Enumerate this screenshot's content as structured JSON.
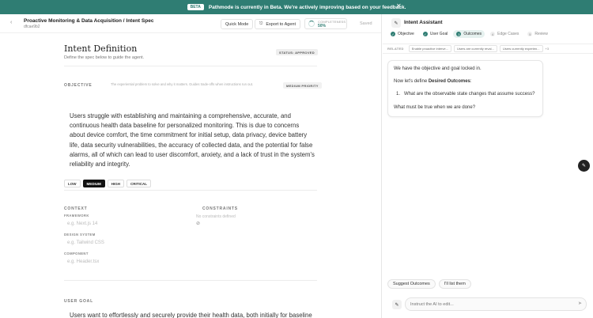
{
  "beta": {
    "badge": "BETA",
    "message": "Pathmode is currently in Beta. We're actively improving based on your feedback.",
    "close": "✕"
  },
  "topbar": {
    "title": "Proactive Monitoring & Data Acquisition / Intent Spec",
    "id": "dfcae9b2",
    "quick_mode": "Quick Mode",
    "export_label": "Export to Agent",
    "completeness_label": "COMPLETENESS",
    "completeness_value": "50%",
    "saved": "Saved"
  },
  "intent": {
    "title": "Intent Definition",
    "subtitle": "Define the spec below to guide the agent.",
    "status": "STATUS: APPROVED"
  },
  "objective": {
    "label": "OBJECTIVE",
    "description": "The experiential problem to solve and why it matters. Guides trade-offs when instructions run out.",
    "priority_badge": "MEDIUM PRIORITY",
    "text": "Users struggle with establishing and maintaining a comprehensive, accurate, and continuous health data baseline for personalized monitoring. This is due to concerns about device comfort, the time commitment for initial setup, data privacy, device battery life, data security vulnerabilities, the accuracy of collected data, and the potential for false alarms, all of which can lead to user discomfort, anxiety, and a lack of trust in the system's reliability and integrity.",
    "priorities": [
      "LOW",
      "MEDIUM",
      "HIGH",
      "CRITICAL"
    ],
    "selected_priority": "MEDIUM"
  },
  "context": {
    "label": "CONTEXT",
    "framework_label": "FRAMEWORK",
    "framework_ph": "e.g. Next.js 14",
    "design_label": "DESIGN SYSTEM",
    "design_ph": "e.g. Tailwind CSS",
    "component_label": "COMPONENT",
    "component_ph": "e.g. Header.tsx"
  },
  "constraints": {
    "label": "CONSTRAINTS",
    "empty": "No constraints defined"
  },
  "user_goal": {
    "label": "USER GOAL",
    "text": "Users want to effortlessly and securely provide their health data, both initially for baseline"
  },
  "assistant": {
    "title": "Intent Assistant",
    "steps": [
      {
        "label": "Objective",
        "state": "done",
        "mark": "✓"
      },
      {
        "label": "User Goal",
        "state": "done",
        "mark": "✓"
      },
      {
        "label": "Outcomes",
        "state": "active",
        "mark": "3"
      },
      {
        "label": "Edge Cases",
        "state": "todo",
        "mark": "4"
      },
      {
        "label": "Review",
        "state": "todo",
        "mark": "5"
      }
    ],
    "related_label": "RELATED",
    "related": [
      "Enable proactive interve...",
      "Users are currently reval...",
      "Users currently experien..."
    ],
    "related_more": "+3",
    "chat": {
      "line1": "We have the objective and goal locked in.",
      "line2_prefix": "Now let's define ",
      "line2_bold": "Desired Outcomes",
      "line2_suffix": ":",
      "item_num": "1.",
      "item_text": "What are the observable state changes that assume success?",
      "line4": "What must be true when we are done?"
    },
    "quick_replies": [
      "Suggest Outcomes",
      "I'll list them"
    ],
    "input_placeholder": "Instruct the AI to edit..."
  }
}
